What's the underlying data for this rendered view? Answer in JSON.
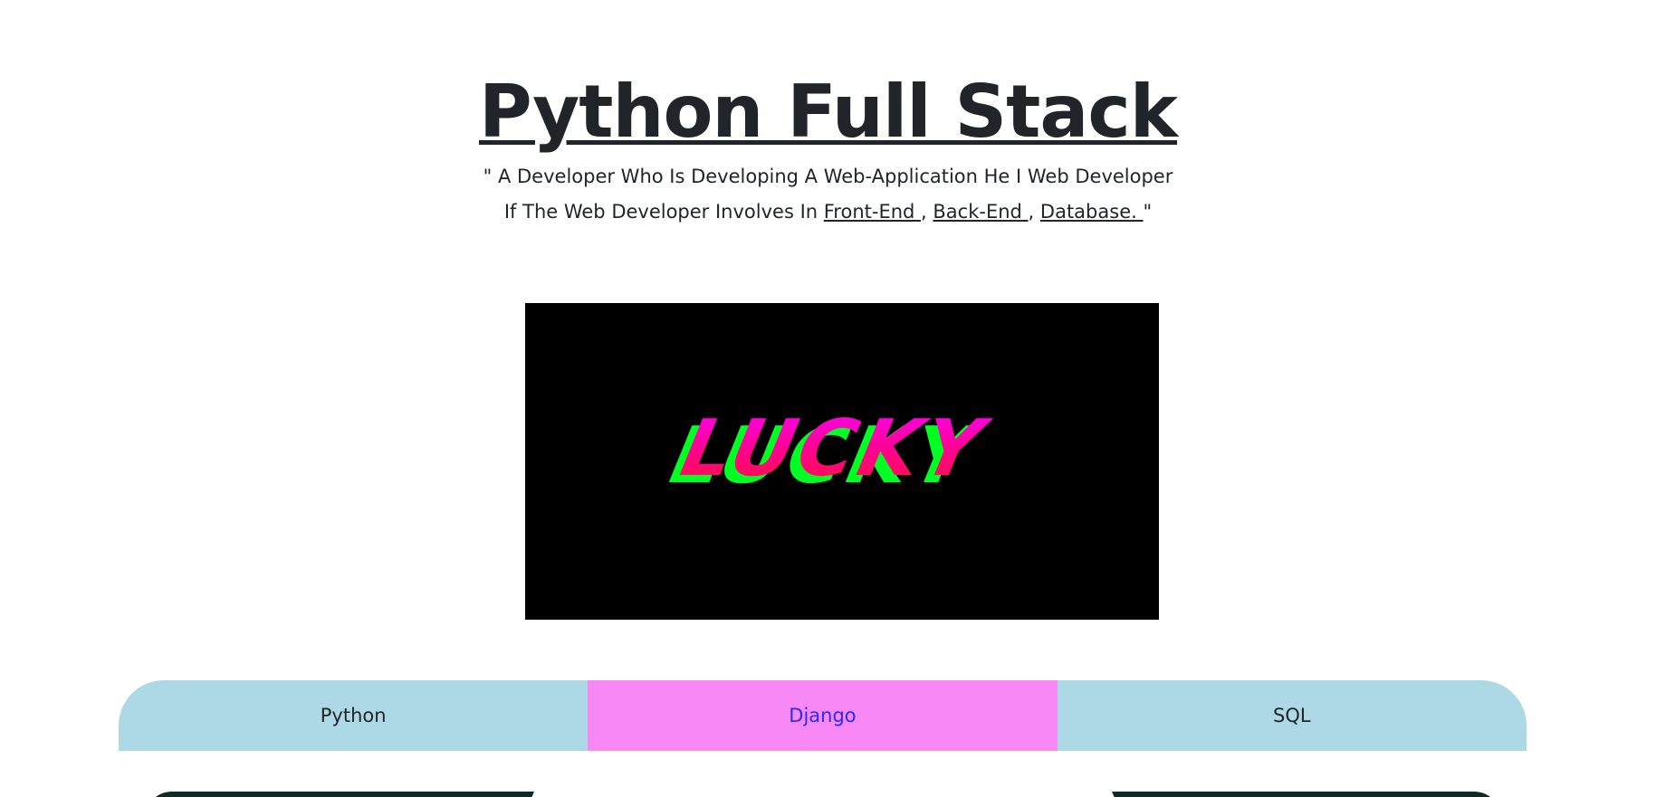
{
  "hero": {
    "title": "Python Full Stack"
  },
  "tagline": {
    "line1": "\" A Developer Who Is Developing A Web-Application He I Web Developer",
    "line2_prefix": "If The Web Developer Involves In ",
    "front_end": "Front-End ",
    "sep1": " , ",
    "back_end": "Back-End ",
    "sep2": " , ",
    "database": "Database. ",
    "line2_suffix": "\""
  },
  "media": {
    "logo_text": "LUCKY",
    "colors": {
      "background": "#000000",
      "shadow": "#00ff22",
      "fill_top": "#ff00ee",
      "fill_bottom": "#ff1144"
    }
  },
  "tabs": {
    "items": [
      {
        "label": "Python",
        "active": false
      },
      {
        "label": "Django",
        "active": true
      },
      {
        "label": "SQL",
        "active": false
      }
    ],
    "colors": {
      "inactive_bg": "#add8e6",
      "active_bg": "#f788f5",
      "active_text": "#2c2cf5"
    }
  },
  "cards": {
    "color": "#0d2a24"
  }
}
